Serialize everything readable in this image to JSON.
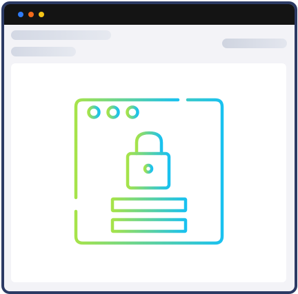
{
  "window": {
    "traffic_lights": [
      {
        "name": "close",
        "color": "#2f7bf6"
      },
      {
        "name": "minimize",
        "color": "#f26a1b"
      },
      {
        "name": "maximize",
        "color": "#f5c518"
      }
    ],
    "frame_color": "#2c3a64",
    "titlebar_color": "#141414"
  },
  "illustration": {
    "icon": "secure-browser-lock-icon",
    "gradient": {
      "start": "#a6e34a",
      "end": "#19c1f0"
    }
  }
}
